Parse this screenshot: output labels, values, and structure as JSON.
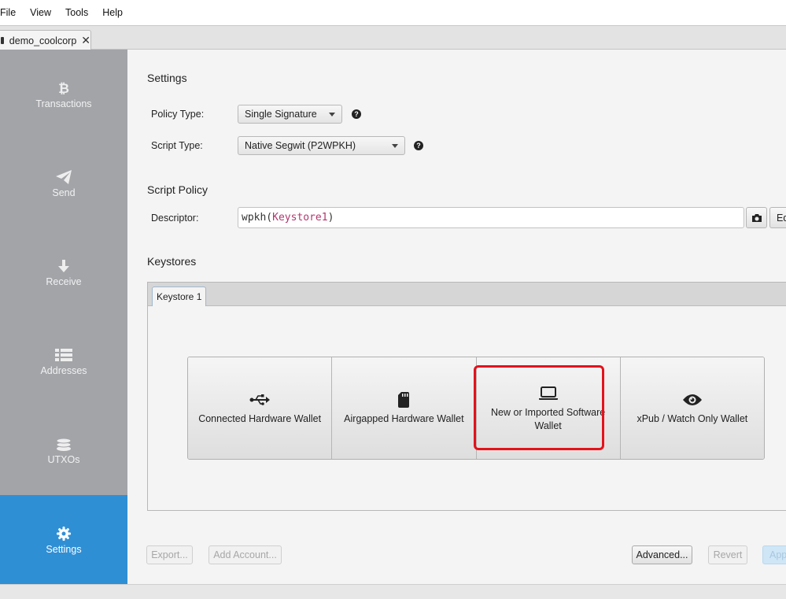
{
  "menu": [
    "File",
    "View",
    "Tools",
    "Help"
  ],
  "file_tab": {
    "label": "demo_coolcorp",
    "close": "✕"
  },
  "sidebar": {
    "items": [
      {
        "label": "Transactions",
        "icon": "bitcoin-icon"
      },
      {
        "label": "Send",
        "icon": "paper-plane-icon"
      },
      {
        "label": "Receive",
        "icon": "arrow-down-icon"
      },
      {
        "label": "Addresses",
        "icon": "list-icon"
      },
      {
        "label": "UTXOs",
        "icon": "coins-icon"
      },
      {
        "label": "Settings",
        "icon": "gear-icon",
        "active": true
      }
    ]
  },
  "settings": {
    "title": "Settings",
    "policy_type_label": "Policy Type:",
    "policy_type_value": "Single Signature",
    "script_type_label": "Script Type:",
    "script_type_value": "Native Segwit (P2WPKH)"
  },
  "script_policy": {
    "title": "Script Policy",
    "descriptor_label": "Descriptor:",
    "descriptor_prefix": "wpkh(",
    "descriptor_keyword": "Keystore1",
    "descriptor_suffix": ")",
    "edit_label": "Ed"
  },
  "keystores": {
    "title": "Keystores",
    "tab_label": "Keystore 1",
    "options": [
      {
        "label": "Connected Hardware Wallet",
        "icon": "usb-icon"
      },
      {
        "label": "Airgapped Hardware Wallet",
        "icon": "sd-card-icon"
      },
      {
        "label": "New or Imported Software Wallet",
        "icon": "laptop-icon"
      },
      {
        "label": "xPub / Watch Only Wallet",
        "icon": "eye-icon"
      }
    ]
  },
  "footer": {
    "export": "Export...",
    "add_account": "Add Account...",
    "advanced": "Advanced...",
    "revert": "Revert",
    "apply": "App"
  },
  "colors": {
    "sidebar": "#a2a4a8",
    "sidebar_active": "#2f8fd5",
    "highlight": "#e4121b",
    "descriptor_keyword": "#b1376c"
  }
}
